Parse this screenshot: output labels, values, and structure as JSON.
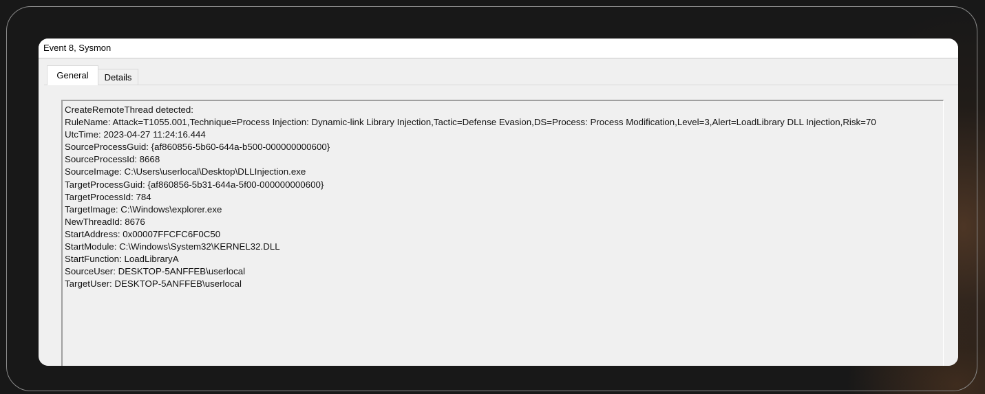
{
  "window": {
    "title": "Event 8, Sysmon"
  },
  "tabs": [
    {
      "label": "General",
      "selected": true
    },
    {
      "label": "Details",
      "selected": false
    }
  ],
  "event": {
    "header": "CreateRemoteThread detected:",
    "rule_name": "RuleName: Attack=T1055.001,Technique=Process Injection: Dynamic-link Library Injection,Tactic=Defense Evasion,DS=Process: Process Modification,Level=3,Alert=LoadLibrary DLL Injection,Risk=70",
    "utc_time": "UtcTime: 2023-04-27 11:24:16.444",
    "source_process_guid": "SourceProcessGuid: {af860856-5b60-644a-b500-000000000600}",
    "source_process_id": "SourceProcessId: 8668",
    "source_image": "SourceImage: C:\\Users\\userlocal\\Desktop\\DLLInjection.exe",
    "target_process_guid": "TargetProcessGuid: {af860856-5b31-644a-5f00-000000000600}",
    "target_process_id": "TargetProcessId: 784",
    "target_image": "TargetImage: C:\\Windows\\explorer.exe",
    "new_thread_id": "NewThreadId: 8676",
    "start_address": "StartAddress: 0x00007FFCFC6F0C50",
    "start_module": "StartModule: C:\\Windows\\System32\\KERNEL32.DLL",
    "start_function": "StartFunction: LoadLibraryA",
    "source_user": "SourceUser: DESKTOP-5ANFFEB\\userlocal",
    "target_user": "TargetUser: DESKTOP-5ANFFEB\\userlocal"
  }
}
